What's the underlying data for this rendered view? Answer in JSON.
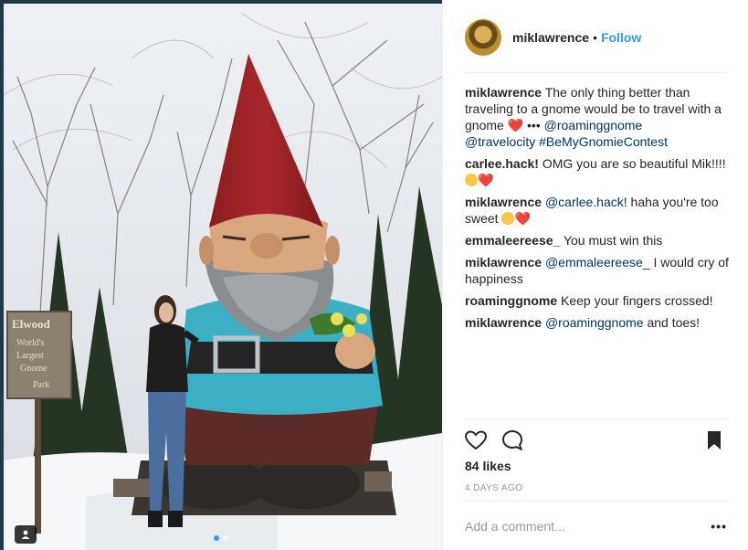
{
  "post": {
    "username": "miklawrence",
    "separator": "•",
    "follow_label": "Follow",
    "caption": {
      "user": "miklawrence",
      "text": " The only thing better than traveling to a gnome would be to travel with a gnome ",
      "heart": "❤️",
      "dots": " ••• ",
      "mention1": "@roaminggnome",
      "mention2": "@travelocity",
      "hashtag": "#BeMyGnomieContest"
    },
    "comments": [
      {
        "user": "carlee.hack!",
        "text": " OMG you are so beautiful Mik!!!! "
      },
      {
        "user": "miklawrence",
        "mention": "@carlee.hack!",
        "text": " haha you're too sweet "
      },
      {
        "user": "emmaleereese_",
        "text": " You must win this"
      },
      {
        "user": "miklawrence",
        "mention": "@emmaleereese_",
        "text": " I would cry of happiness"
      },
      {
        "user": "roaminggnome",
        "text": " Keep your fingers crossed!"
      },
      {
        "user": "miklawrence",
        "mention": "@roaminggnome",
        "text": " and toes!"
      }
    ],
    "likes": "84 likes",
    "time_ago": "4 DAYS AGO",
    "comment_placeholder": "Add a comment...",
    "more_label": "•••",
    "sign_text": {
      "line1": "Elwood",
      "line2": "World's",
      "line3": "Largest",
      "line4": "Gnome",
      "line5": "Park"
    }
  },
  "colors": {
    "link": "#3897f0",
    "mention": "#003569",
    "heart": "#ed2c3e"
  },
  "icons": [
    "heart-icon",
    "comment-icon",
    "bookmark-icon",
    "user-tag-icon"
  ]
}
